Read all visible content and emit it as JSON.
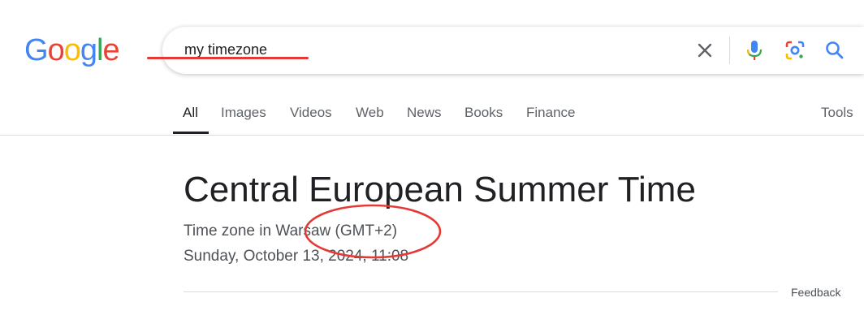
{
  "logo": {
    "letters": [
      "G",
      "o",
      "o",
      "g",
      "l",
      "e"
    ],
    "colors": [
      "#4285F4",
      "#EA4335",
      "#FBBC05",
      "#4285F4",
      "#34A853",
      "#EA4335"
    ]
  },
  "search": {
    "query": "my timezone",
    "icons": [
      "close-icon",
      "microphone-icon",
      "lens-icon",
      "search-icon"
    ]
  },
  "tabs": [
    {
      "label": "All",
      "active": true
    },
    {
      "label": "Images"
    },
    {
      "label": "Videos"
    },
    {
      "label": "Web"
    },
    {
      "label": "News"
    },
    {
      "label": "Books"
    },
    {
      "label": "Finance"
    }
  ],
  "tools_label": "Tools",
  "result": {
    "title": "Central European Summer Time",
    "subtitle": "Time zone in Warsaw (GMT+2)",
    "datetime": "Sunday, October 13, 2024, 11:08"
  },
  "feedback_label": "Feedback",
  "annotation_color": "#e53935"
}
